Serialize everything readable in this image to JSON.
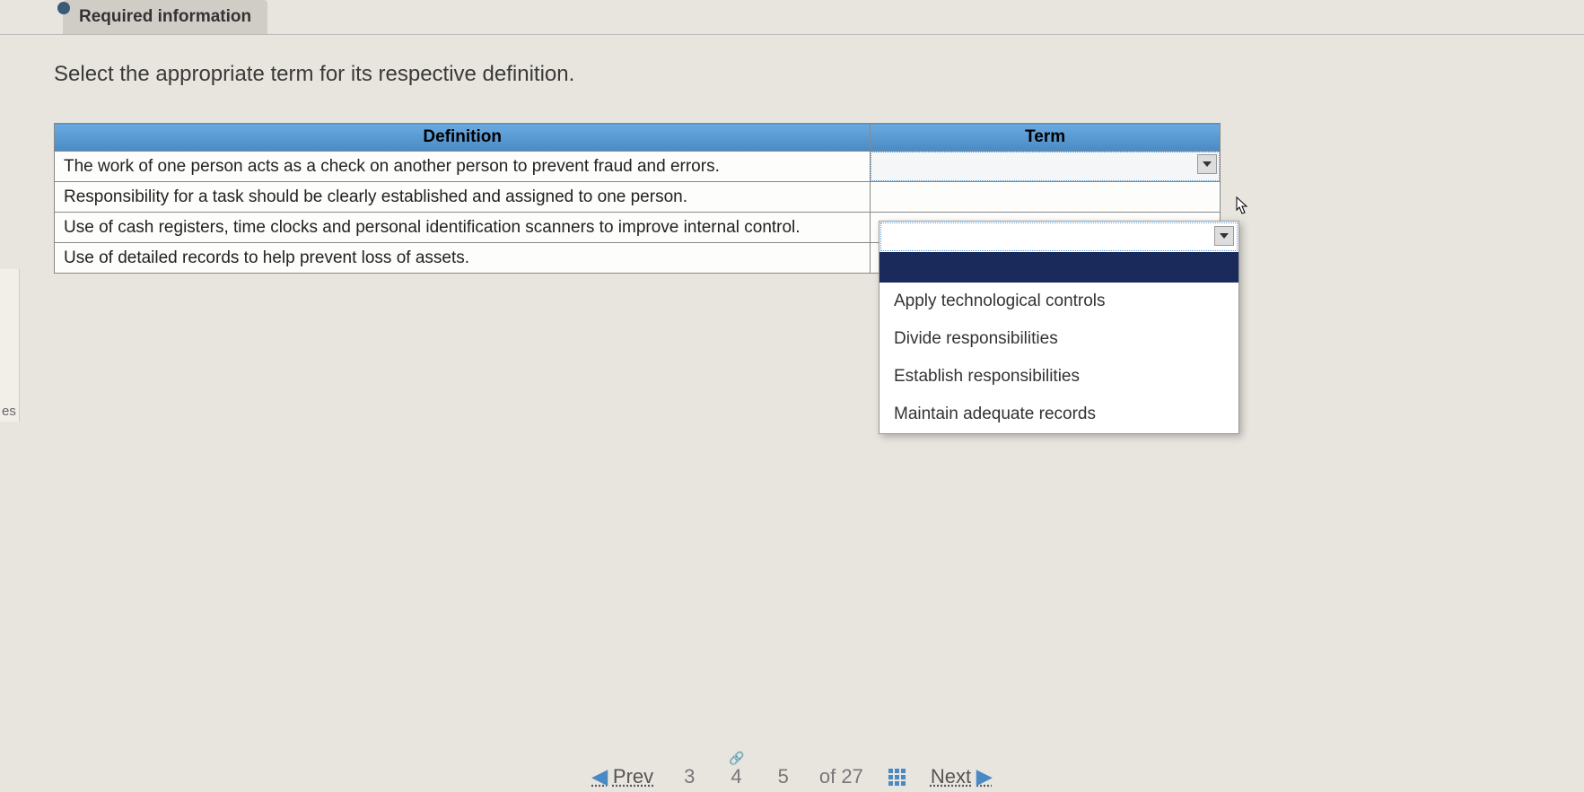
{
  "header": {
    "tab_label": "Required information"
  },
  "instruction": "Select the appropriate term for its respective definition.",
  "table": {
    "headers": {
      "definition": "Definition",
      "term": "Term"
    },
    "rows": [
      {
        "definition": "The work of one person acts as a check on another person to prevent fraud and errors."
      },
      {
        "definition": "Responsibility for a task should be clearly established and assigned to one person."
      },
      {
        "definition": "Use of cash registers, time clocks and personal identification scanners to improve internal control."
      },
      {
        "definition": "Use of detailed records to help prevent loss of assets."
      }
    ]
  },
  "dropdown": {
    "options": [
      "Apply technological controls",
      "Divide responsibilities",
      "Establish responsibilities",
      "Maintain adequate records"
    ]
  },
  "sidebar_stub": "es",
  "pager": {
    "prev": "Prev",
    "next": "Next",
    "pages": [
      "3",
      "4",
      "5"
    ],
    "current": "4",
    "of_label": "of",
    "total": "27"
  }
}
